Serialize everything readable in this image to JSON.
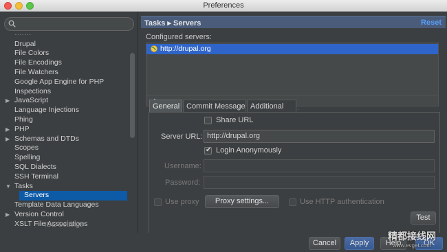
{
  "window": {
    "title": "Preferences"
  },
  "search": {
    "placeholder": ""
  },
  "tree": {
    "items": [
      {
        "label": "Drupal"
      },
      {
        "label": "File Colors"
      },
      {
        "label": "File Encodings"
      },
      {
        "label": "File Watchers"
      },
      {
        "label": "Google App Engine for PHP"
      },
      {
        "label": "Inspections"
      },
      {
        "label": "JavaScript"
      },
      {
        "label": "Language Injections"
      },
      {
        "label": "Phing"
      },
      {
        "label": "PHP"
      },
      {
        "label": "Schemas and DTDs"
      },
      {
        "label": "Scopes"
      },
      {
        "label": "Spelling"
      },
      {
        "label": "SQL Dialects"
      },
      {
        "label": "SSH Terminal"
      },
      {
        "label": "Tasks"
      },
      {
        "label": "Servers"
      },
      {
        "label": "Template Data Languages"
      },
      {
        "label": "Version Control"
      },
      {
        "label": "XSLT File Associations"
      }
    ],
    "footer": "IDE Settings"
  },
  "header": {
    "breadcrumb": "Tasks ▸ Servers",
    "reset_label": "Reset"
  },
  "servers": {
    "label": "Configured servers:",
    "selected": "http://drupal.org",
    "add": "+",
    "remove": "−"
  },
  "tabs": [
    "General",
    "Commit Message",
    "Additional"
  ],
  "general": {
    "share_url": "Share URL",
    "server_url_label": "Server URL:",
    "server_url_value": "http://drupal.org",
    "login_anon": "Login Anonymously",
    "username_label": "Username:",
    "password_label": "Password:",
    "use_proxy": "Use proxy",
    "proxy_settings": "Proxy settings...",
    "use_http_auth": "Use HTTP authentication",
    "test": "Test"
  },
  "footer": {
    "cancel": "Cancel",
    "apply": "Apply",
    "help": "Help",
    "ok": "OK"
  },
  "watermark": {
    "line1": "精都接线网",
    "line2": "www.evget.com"
  }
}
